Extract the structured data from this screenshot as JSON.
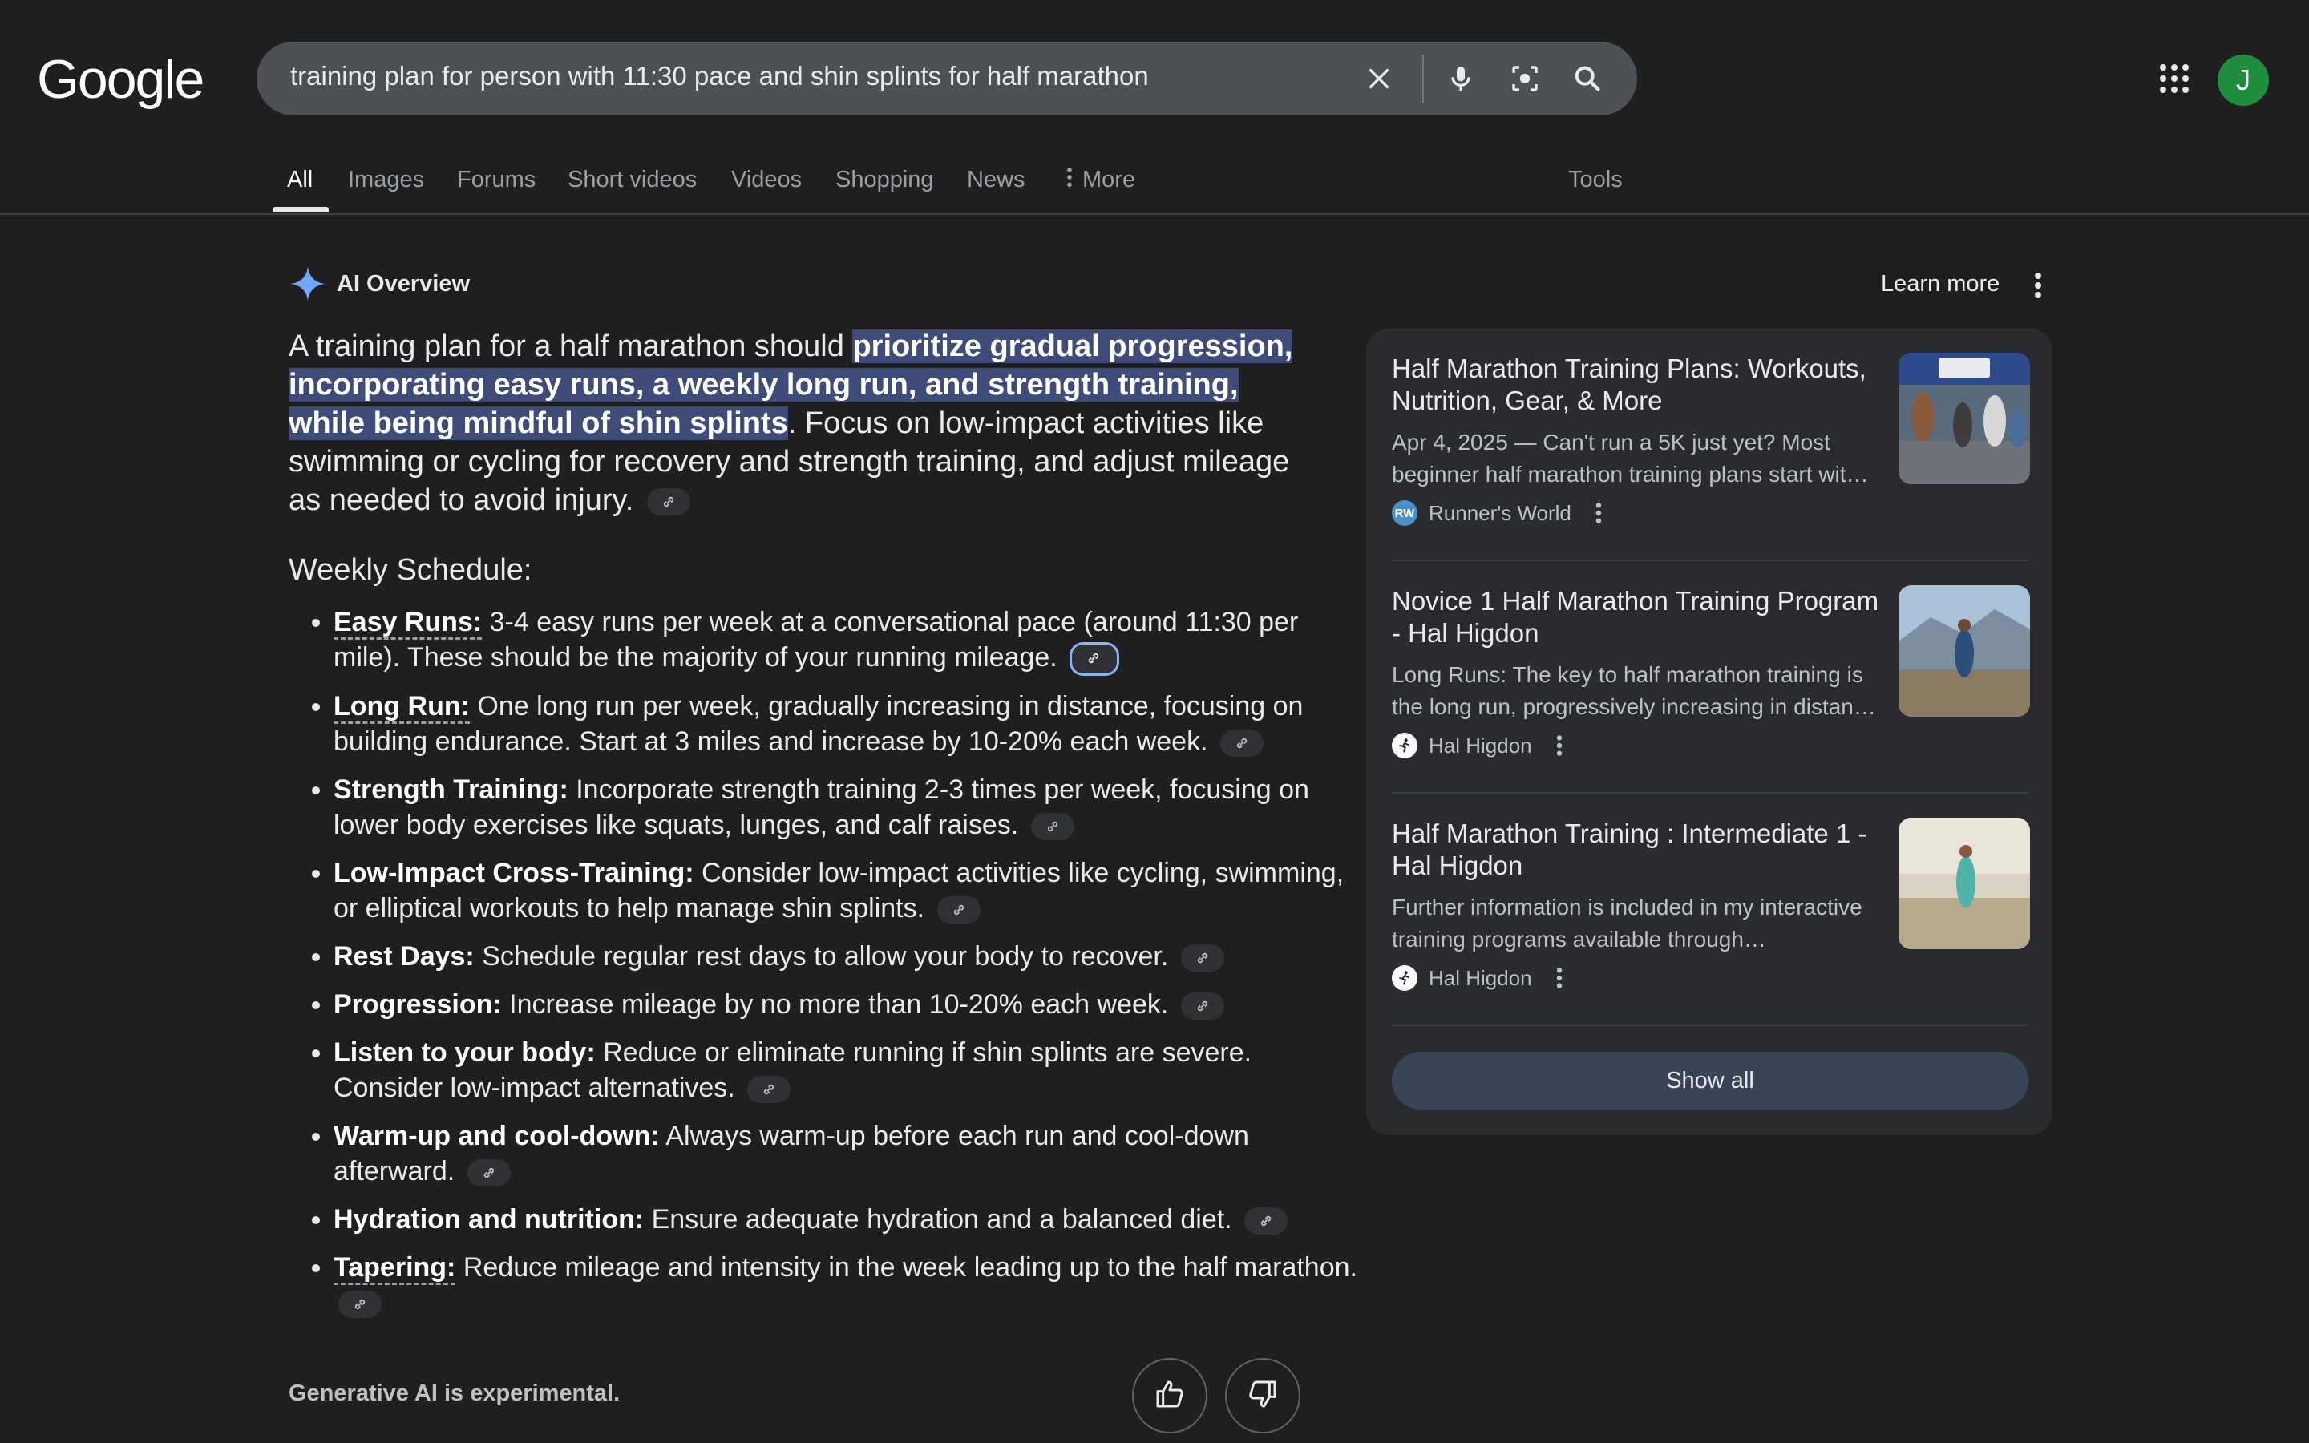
{
  "header": {
    "logo": "Google",
    "search_query": "training plan for person with 11:30 pace and shin splints for half marathon",
    "avatar_initial": "J"
  },
  "tabs": [
    {
      "label": "All",
      "active": true
    },
    {
      "label": "Images"
    },
    {
      "label": "Forums"
    },
    {
      "label": "Short videos"
    },
    {
      "label": "Videos"
    },
    {
      "label": "Shopping"
    },
    {
      "label": "News"
    },
    {
      "label": "More"
    }
  ],
  "tools_label": "Tools",
  "ai_overview": {
    "title": "AI Overview",
    "learn_more": "Learn more",
    "intro_prefix": "A training plan for a half marathon should ",
    "intro_highlight": "prioritize gradual progression, incorporating easy runs, a weekly long run, and strength training, while being mindful of shin splints",
    "intro_suffix": ". Focus on low-impact activities like swimming or cycling for recovery and strength training, and adjust mileage as needed to avoid injury.",
    "schedule_title": "Weekly Schedule:",
    "bullets": [
      {
        "term": "Easy Runs:",
        "text": " 3-4 easy runs per week at a conversational pace (around 11:30 per mile). These should be the majority of your running mileage."
      },
      {
        "term": "Long Run:",
        "text": " One long run per week, gradually increasing in distance, focusing on building endurance. Start at 3 miles and increase by 10-20% each week."
      },
      {
        "term": "Strength Training:",
        "text": " Incorporate strength training 2-3 times per week, focusing on lower body exercises like squats, lunges, and calf raises."
      },
      {
        "term": "Low-Impact Cross-Training:",
        "text": " Consider low-impact activities like cycling, swimming, or elliptical workouts to help manage shin splints."
      },
      {
        "term": "Rest Days:",
        "text": " Schedule regular rest days to allow your body to recover."
      },
      {
        "term": "Progression:",
        "text": " Increase mileage by no more than 10-20% each week."
      },
      {
        "term": "Listen to your body:",
        "text": " Reduce or eliminate running if shin splints are severe. Consider low-impact alternatives."
      },
      {
        "term": "Warm-up and cool-down:",
        "text": " Always warm-up before each run and cool-down afterward."
      },
      {
        "term": "Hydration and nutrition:",
        "text": " Ensure adequate hydration and a balanced diet."
      },
      {
        "term": "Tapering:",
        "text": " Reduce mileage and intensity in the week leading up to the half marathon."
      }
    ],
    "footer_note": "Generative AI is experimental."
  },
  "sources": [
    {
      "title": "Half Marathon Training Plans: Workouts, Nutrition, Gear, & More",
      "snippet": "Apr 4, 2025 — Can't run a 5K just yet? Most beginner half marathon training plans start wit…",
      "site": "Runner's World",
      "logo_text": "RW",
      "logo_color": "#4a90c8"
    },
    {
      "title": "Novice 1 Half Marathon Training Program - Hal Higdon",
      "snippet": "Long Runs: The key to half marathon training is the long run, progressively increasing in distan…",
      "site": "Hal Higdon",
      "logo_text": "",
      "logo_color": "#ffffff"
    },
    {
      "title": "Half Marathon Training : Intermediate 1 - Hal Higdon",
      "snippet": "Further information is included in my interactive training programs available through…",
      "site": "Hal Higdon",
      "logo_text": "",
      "logo_color": "#ffffff"
    }
  ],
  "show_all": "Show all"
}
